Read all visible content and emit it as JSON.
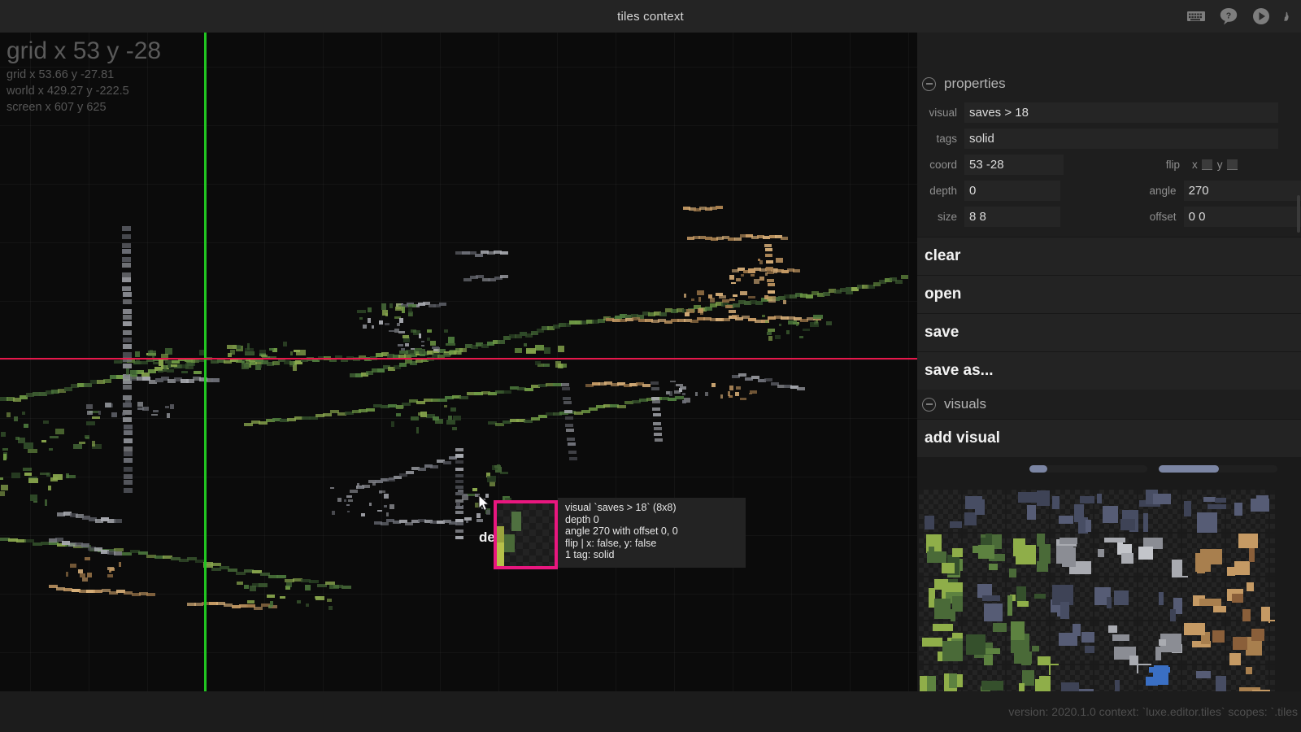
{
  "titlebar": {
    "title": "tiles context",
    "icons": [
      {
        "name": "keyboard-icon",
        "label": "keyboard"
      },
      {
        "name": "help-icon",
        "label": "help"
      },
      {
        "name": "play-icon",
        "label": "play"
      },
      {
        "name": "luxe-logo-icon",
        "label": "luxe"
      }
    ]
  },
  "canvas": {
    "readout": {
      "grid_round": "grid x 53 y -28",
      "grid_exact": "grid x 53.66 y -27.81",
      "world": "world x 429.27 y -222.5",
      "screen": "screen x 607 y 625"
    },
    "axis_color_v": "#21c521",
    "axis_color_h": "#e8174b",
    "partial_label": "de"
  },
  "tooltip": {
    "border_color": "#e8177f",
    "lines": [
      "visual `saves > 18` (8x8)",
      "depth 0",
      "angle 270 with offset 0, 0",
      "flip | x: false, y: false",
      "1 tag: solid"
    ]
  },
  "panel": {
    "properties": {
      "title": "properties",
      "visual_label": "visual",
      "visual_value": "saves > 18",
      "tags_label": "tags",
      "tags_value": "solid",
      "coord_label": "coord",
      "coord_value": "53 -28",
      "flip_label": "flip",
      "flip_x_label": "x",
      "flip_y_label": "y",
      "depth_label": "depth",
      "depth_value": "0",
      "angle_label": "angle",
      "angle_value": "270",
      "size_label": "size",
      "size_value": "8 8",
      "offset_label": "offset",
      "offset_value": "0 0"
    },
    "menu": [
      {
        "label": "clear",
        "name": "clear"
      },
      {
        "label": "open",
        "name": "open"
      },
      {
        "label": "save",
        "name": "save"
      },
      {
        "label": "save as...",
        "name": "save-as"
      }
    ],
    "visuals": {
      "title": "visuals",
      "add_label": "add visual"
    }
  },
  "statusbar": {
    "text": "version: 2020.1.0 context: `luxe.editor.tiles` scopes: `.tiles"
  }
}
